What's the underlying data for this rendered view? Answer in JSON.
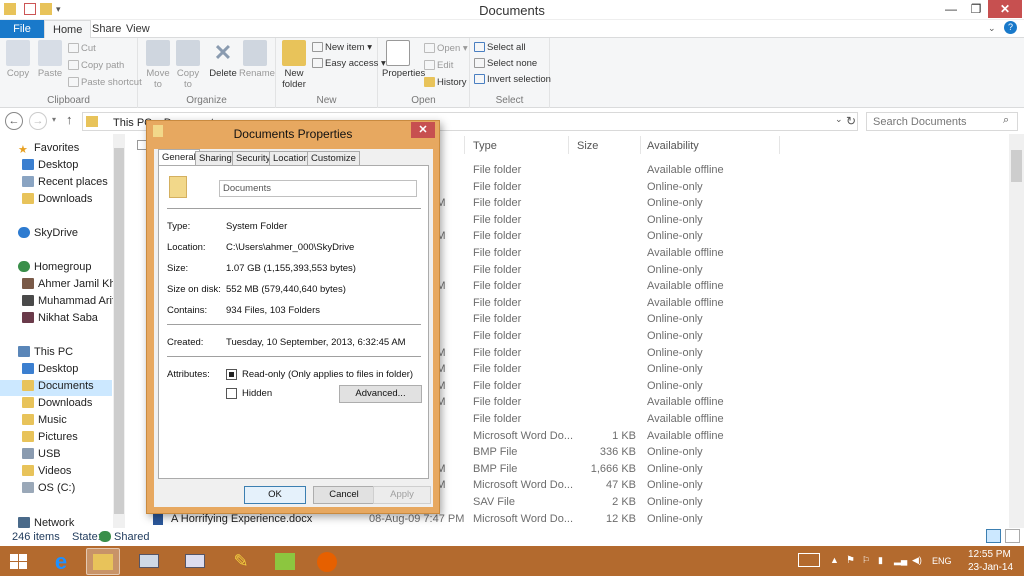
{
  "window": {
    "title": "Documents"
  },
  "ribbon_tabs": [
    "File",
    "Home",
    "Share",
    "View"
  ],
  "ribbon": {
    "clipboard": {
      "label": "Clipboard",
      "copy": "Copy",
      "paste": "Paste",
      "cut": "Cut",
      "copy_path": "Copy path",
      "paste_shortcut": "Paste shortcut"
    },
    "organize": {
      "label": "Organize",
      "move_to": "Move to",
      "copy_to": "Copy to",
      "delete": "Delete",
      "rename": "Rename"
    },
    "new": {
      "label": "New",
      "new_folder": "New folder",
      "new_item": "New item",
      "easy_access": "Easy access"
    },
    "open": {
      "label": "Open",
      "properties": "Properties",
      "open": "Open",
      "edit": "Edit",
      "history": "History"
    },
    "select": {
      "label": "Select",
      "select_all": "Select all",
      "select_none": "Select none",
      "invert_selection": "Invert selection"
    }
  },
  "address": {
    "path": "This PC ▸ Documents",
    "search_placeholder": "Search Documents"
  },
  "nav": {
    "favorites": "Favorites",
    "desktop": "Desktop",
    "recent": "Recent places",
    "downloads": "Downloads",
    "skydrive": "SkyDrive",
    "homegroup": "Homegroup",
    "hg1": "Ahmer Jamil Khan",
    "hg2": "Muhammad Arif K",
    "hg3": "Nikhat Saba",
    "thispc": "This PC",
    "pc_desktop": "Desktop",
    "pc_documents": "Documents",
    "pc_downloads": "Downloads",
    "pc_music": "Music",
    "pc_pictures": "Pictures",
    "pc_usb": "USB",
    "pc_videos": "Videos",
    "pc_os": "OS (C:)",
    "network": "Network"
  },
  "columns": {
    "type": "Type",
    "size": "Size",
    "availability": "Availability"
  },
  "rows": [
    {
      "t": "M",
      "type": "File folder",
      "size": "",
      "avail": "Available offline"
    },
    {
      "t": "M",
      "type": "File folder",
      "size": "",
      "avail": "Online-only"
    },
    {
      "t": "PM",
      "type": "File folder",
      "size": "",
      "avail": "Online-only"
    },
    {
      "t": "M",
      "type": "File folder",
      "size": "",
      "avail": "Online-only"
    },
    {
      "t": "PM",
      "type": "File folder",
      "size": "",
      "avail": "Online-only"
    },
    {
      "t": "M",
      "type": "File folder",
      "size": "",
      "avail": "Available offline"
    },
    {
      "t": "M",
      "type": "File folder",
      "size": "",
      "avail": "Online-only"
    },
    {
      "t": "PM",
      "type": "File folder",
      "size": "",
      "avail": "Available offline"
    },
    {
      "t": "M",
      "type": "File folder",
      "size": "",
      "avail": "Available offline"
    },
    {
      "t": "M",
      "type": "File folder",
      "size": "",
      "avail": "Online-only"
    },
    {
      "t": "M",
      "type": "File folder",
      "size": "",
      "avail": "Online-only"
    },
    {
      "t": "PM",
      "type": "File folder",
      "size": "",
      "avail": "Online-only"
    },
    {
      "t": "PM",
      "type": "File folder",
      "size": "",
      "avail": "Online-only"
    },
    {
      "t": "PM",
      "type": "File folder",
      "size": "",
      "avail": "Online-only"
    },
    {
      "t": "AM",
      "type": "File folder",
      "size": "",
      "avail": "Available offline"
    },
    {
      "t": "M",
      "type": "File folder",
      "size": "",
      "avail": "Available offline"
    },
    {
      "t": "M",
      "type": "Microsoft Word Do...",
      "size": "1 KB",
      "avail": "Available offline"
    },
    {
      "t": "M",
      "type": "BMP File",
      "size": "336 KB",
      "avail": "Online-only"
    },
    {
      "t": "PM",
      "type": "BMP File",
      "size": "1,666 KB",
      "avail": "Online-only"
    },
    {
      "t": "AM",
      "type": "Microsoft Word Do...",
      "size": "47 KB",
      "avail": "Online-only"
    },
    {
      "t": "M",
      "type": "SAV File",
      "size": "2 KB",
      "avail": "Online-only"
    }
  ],
  "last_row": {
    "name": "A Horrifying Experience.docx",
    "date": "08-Aug-09 7:47 PM",
    "type": "Microsoft Word Do...",
    "size": "12 KB",
    "avail": "Online-only"
  },
  "status": {
    "items": "246 items",
    "state": "State:",
    "shared": "Shared"
  },
  "dialog": {
    "title": "Documents Properties",
    "close": "✕",
    "tabs": [
      "General",
      "Sharing",
      "Security",
      "Location",
      "Customize"
    ],
    "name_value": "Documents",
    "type_label": "Type:",
    "type_value": "System Folder",
    "location_label": "Location:",
    "location_value": "C:\\Users\\ahmer_000\\SkyDrive",
    "size_label": "Size:",
    "size_value": "1.07 GB (1,155,393,553 bytes)",
    "size_on_disk_label": "Size on disk:",
    "size_on_disk_value": "552 MB (579,440,640 bytes)",
    "contains_label": "Contains:",
    "contains_value": "934 Files, 103 Folders",
    "created_label": "Created:",
    "created_value": "Tuesday, 10 September, 2013, 6:32:45 AM",
    "attributes_label": "Attributes:",
    "readonly_label": "Read-only (Only applies to files in folder)",
    "hidden_label": "Hidden",
    "advanced": "Advanced...",
    "ok": "OK",
    "cancel": "Cancel",
    "apply": "Apply"
  },
  "tray": {
    "lang": "ENG",
    "time": "12:55 PM",
    "date": "23-Jan-14"
  },
  "colors": {
    "accent": "#1979ca",
    "taskbar": "#b36a2e",
    "dialog_frame": "#e7a860",
    "close_red": "#c75050",
    "folder": "#e8c35a"
  }
}
